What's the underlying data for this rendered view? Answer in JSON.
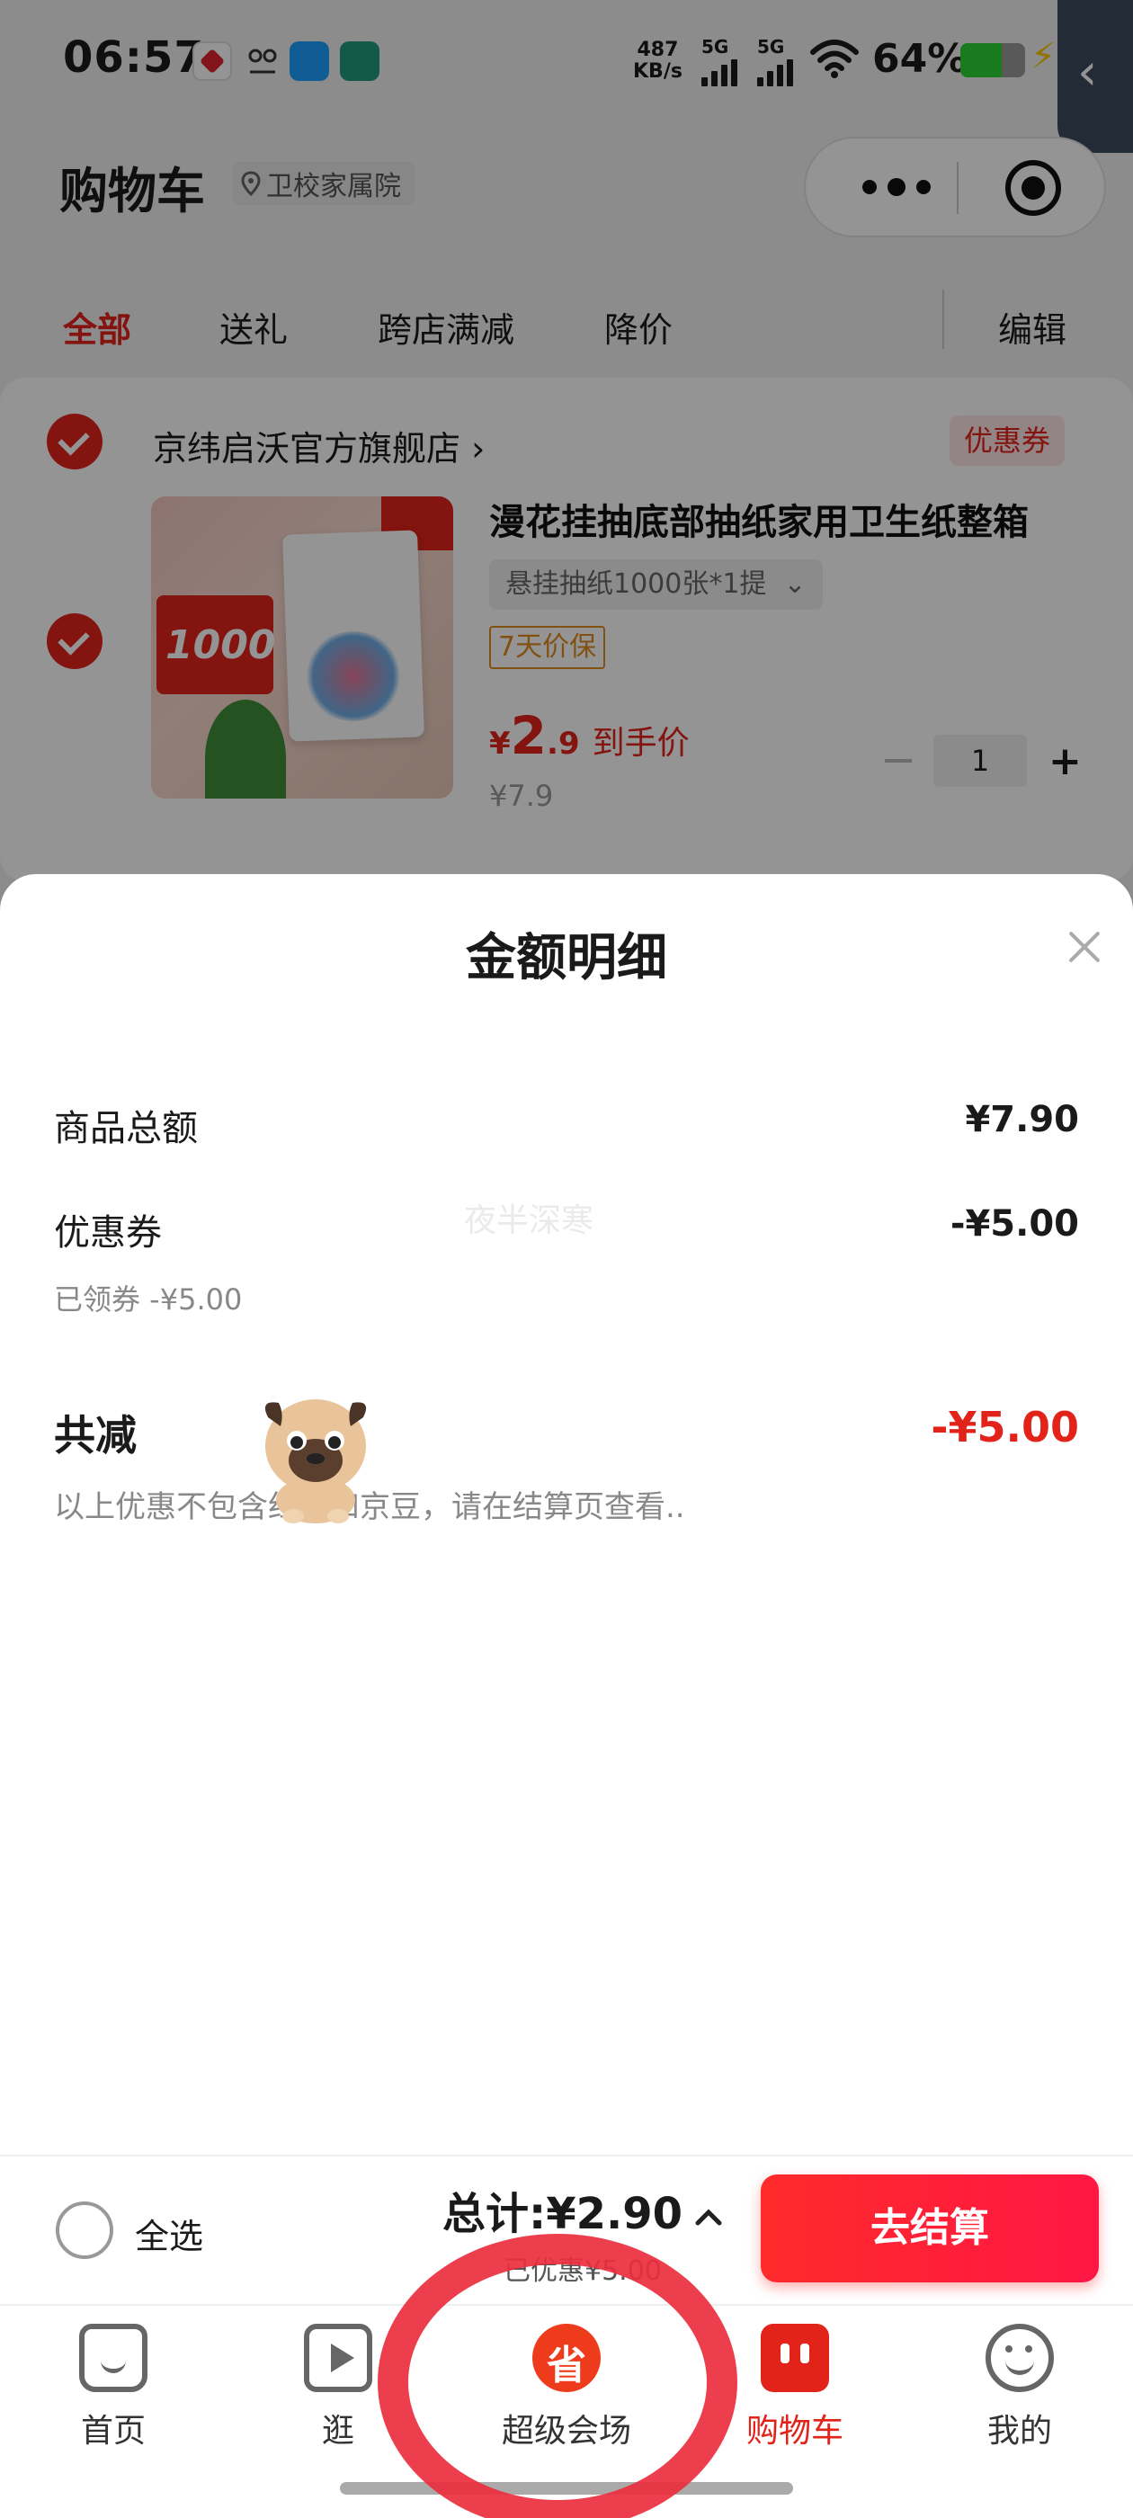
{
  "status_bar": {
    "time": "06:57",
    "net_speed_value": "487",
    "net_speed_unit": "KB/s",
    "signal1_label": "5G",
    "signal2_label": "5G",
    "battery_percent": "64%",
    "battery_level": 0.64,
    "notification_icons": [
      "app-notification-icon",
      "hmm-notification-icon",
      "phone-manager-icon",
      "avatar-app-icon"
    ],
    "charge_glyph": "⚡",
    "side_tab_glyph": "‹"
  },
  "header": {
    "title": "购物车",
    "location": "卫校家属院"
  },
  "tabs": {
    "items": [
      {
        "label": "全部",
        "active": true
      },
      {
        "label": "送礼",
        "active": false
      },
      {
        "label": "跨店满减",
        "active": false
      },
      {
        "label": "降价",
        "active": false
      }
    ],
    "edit_label": "编辑"
  },
  "cart": {
    "shop_name": "京纬启沃官方旗舰店",
    "shop_arrow": "›",
    "coupon_label": "优惠券",
    "product": {
      "title": "漫花挂抽底部抽纸家用卫生纸整箱",
      "sku": "悬挂抽纸1000张*1提",
      "sku_arrow": "⌄",
      "guarantee": "7天价保",
      "price_symbol": "¥",
      "price_int": "2",
      "price_dec": ".9",
      "price_label": "到手价",
      "original_price": "¥7.9",
      "quantity": "1",
      "image_text": "1000"
    }
  },
  "sheet": {
    "title": "金额明细",
    "goods_total_label": "商品总额",
    "goods_total_value": "¥7.90",
    "coupon_label": "优惠券",
    "coupon_value": "-¥5.00",
    "coupon_note": "已领券 -¥5.00",
    "watermark": "夜半深寒",
    "total_reduce_label": "共减",
    "total_reduce_value": "-¥5.00",
    "total_note": "以上优惠不包含红包和京豆，请在结算页查看.."
  },
  "checkout": {
    "select_all": "全选",
    "total": "总计:¥2.90",
    "discount": "已优惠¥5.00",
    "button": "去结算",
    "expand_glyph": "︿"
  },
  "tabbar": {
    "items": [
      {
        "label": "首页",
        "icon": "home-icon",
        "active": false
      },
      {
        "label": "逛",
        "icon": "play-icon",
        "active": false
      },
      {
        "label": "超级会场",
        "icon": "super-venue-icon",
        "active": false,
        "icon_glyph": "省"
      },
      {
        "label": "购物车",
        "icon": "cart-icon",
        "active": true
      },
      {
        "label": "我的",
        "icon": "profile-icon",
        "active": false
      }
    ]
  },
  "colors": {
    "accent": "#e2231a",
    "annotation": "#ea2e3e",
    "checkout_button": "#ff2a2a"
  }
}
